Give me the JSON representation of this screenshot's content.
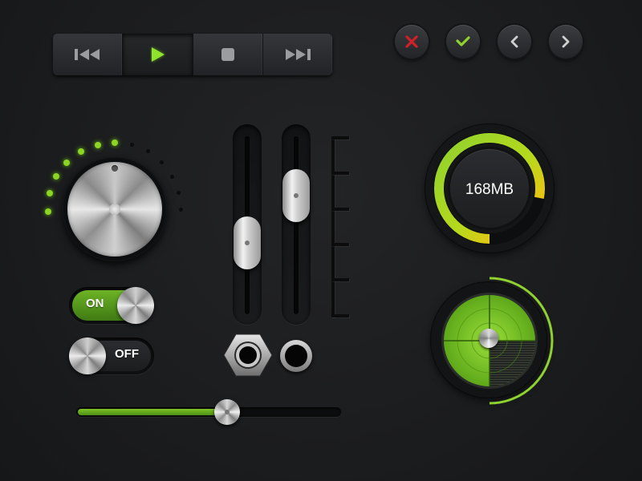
{
  "transport": {
    "buttons": [
      {
        "name": "previous",
        "icon": "skip-back-icon",
        "active": false
      },
      {
        "name": "play",
        "icon": "play-icon",
        "active": true
      },
      {
        "name": "stop",
        "icon": "stop-icon",
        "active": false
      },
      {
        "name": "next",
        "icon": "skip-forward-icon",
        "active": false
      }
    ],
    "active_color": "#7ed321"
  },
  "round_buttons": [
    {
      "name": "cancel",
      "icon": "close-icon",
      "color": "#d0202a"
    },
    {
      "name": "confirm",
      "icon": "check-icon",
      "color": "#8fd12e"
    },
    {
      "name": "back",
      "icon": "chevron-left-icon",
      "color": "#cfcfcf"
    },
    {
      "name": "forward",
      "icon": "chevron-right-icon",
      "color": "#cfcfcf"
    }
  ],
  "volume_knob": {
    "lit_dots": 6,
    "total_dots": 12,
    "accent_color": "#8cd524"
  },
  "toggles": {
    "on_label": "ON",
    "off_label": "OFF"
  },
  "vertical_sliders": [
    {
      "name": "slider-1",
      "value": 0.36
    },
    {
      "name": "slider-2",
      "value": 0.74
    }
  ],
  "horizontal_slider": {
    "value": 0.57,
    "fill_color": "#7ec226"
  },
  "gauge": {
    "label": "168MB",
    "value": 0.78
  },
  "radar": {
    "accent_color": "#8fd12e"
  }
}
